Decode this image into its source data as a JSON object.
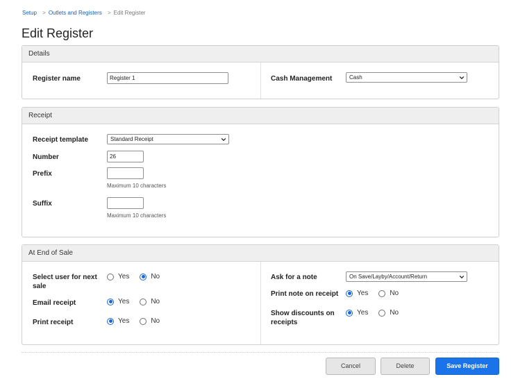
{
  "breadcrumb": {
    "items": [
      "Setup",
      "Outlets and Registers"
    ],
    "current": "Edit Register",
    "separator": ">"
  },
  "page_title": "Edit Register",
  "details": {
    "title": "Details",
    "register_name_label": "Register name",
    "register_name_value": "Register 1",
    "cash_management_label": "Cash Management",
    "cash_management_value": "Cash"
  },
  "receipt": {
    "title": "Receipt",
    "template_label": "Receipt template",
    "template_value": "Standard Receipt",
    "number_label": "Number",
    "number_value": "26",
    "prefix_label": "Prefix",
    "prefix_value": "",
    "prefix_hint": "Maximum 10 characters",
    "suffix_label": "Suffix",
    "suffix_value": "",
    "suffix_hint": "Maximum 10 characters"
  },
  "end_of_sale": {
    "title": "At End of Sale",
    "yes_label": "Yes",
    "no_label": "No",
    "select_user_label": "Select user for next sale",
    "select_user_value": "No",
    "email_receipt_label": "Email receipt",
    "email_receipt_value": "Yes",
    "print_receipt_label": "Print receipt",
    "print_receipt_value": "Yes",
    "ask_note_label": "Ask for a note",
    "ask_note_value": "On Save/Layby/Account/Return",
    "print_note_label": "Print note on receipt",
    "print_note_value": "Yes",
    "show_discounts_label": "Show discounts on receipts",
    "show_discounts_value": "Yes"
  },
  "actions": {
    "cancel_label": "Cancel",
    "delete_label": "Delete",
    "save_label": "Save Register"
  },
  "colors": {
    "primary": "#1a73e8",
    "link": "#1a5fb4",
    "panel_header": "#efefef"
  }
}
